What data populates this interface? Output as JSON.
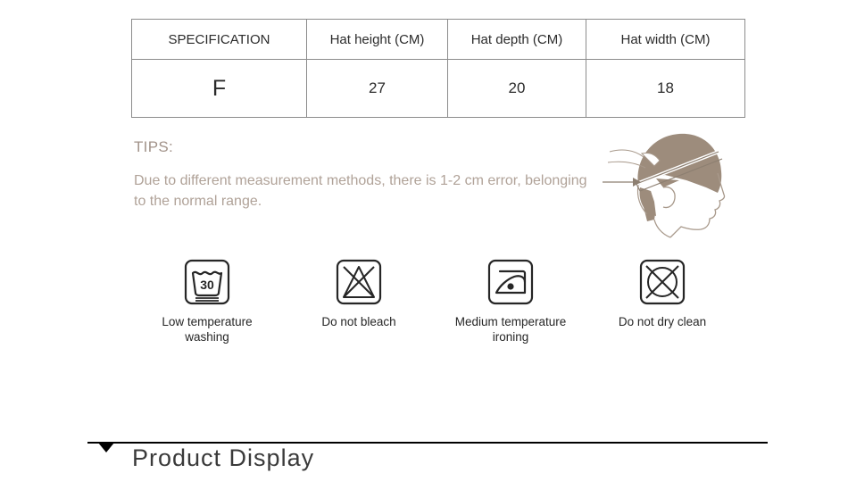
{
  "spec_table": {
    "headers": [
      "SPECIFICATION",
      "Hat height (CM)",
      "Hat depth (CM)",
      "Hat width (CM)"
    ],
    "row": [
      "F",
      "27",
      "20",
      "18"
    ]
  },
  "tips": {
    "title": "TIPS:",
    "body": "Due to different measurement methods, there is 1-2 cm error, belonging to the normal range."
  },
  "illustration": {
    "name": "head-measurement-diagram",
    "fill_color": "#9d8c7c",
    "outline_color": "#a8998b"
  },
  "care_instructions": [
    {
      "icon": "low-temperature-washing-icon",
      "temperature": "30",
      "label": "Low temperature\nwashing"
    },
    {
      "icon": "do-not-bleach-icon",
      "label": "Do not bleach"
    },
    {
      "icon": "medium-temperature-ironing-icon",
      "label": "Medium temperature\nironing"
    },
    {
      "icon": "do-not-dry-clean-icon",
      "label": "Do not dry clean"
    }
  ],
  "section_header": {
    "title": "Product Display",
    "caret_icon": "triangle-down-icon",
    "rule_color": "#000000"
  }
}
